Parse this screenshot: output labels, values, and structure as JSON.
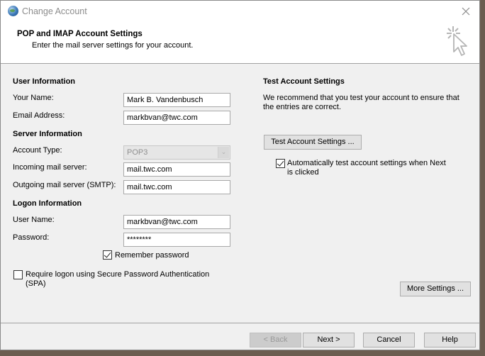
{
  "window": {
    "title": "Change Account",
    "close_icon": "close-icon",
    "app_icon": "outlook-globe-icon"
  },
  "header": {
    "title": "POP and IMAP Account Settings",
    "subtitle": "Enter the mail server settings for your account.",
    "icon": "wizard-cursor-icon"
  },
  "user_information": {
    "heading": "User Information",
    "your_name_label": "Your Name:",
    "your_name_value": "Mark B. Vandenbusch",
    "email_label": "Email Address:",
    "email_value": "markbvan@twc.com"
  },
  "server_information": {
    "heading": "Server Information",
    "account_type_label": "Account Type:",
    "account_type_value": "POP3",
    "incoming_label": "Incoming mail server:",
    "incoming_value": "mail.twc.com",
    "outgoing_label": "Outgoing mail server (SMTP):",
    "outgoing_value": "mail.twc.com"
  },
  "logon_information": {
    "heading": "Logon Information",
    "user_name_label": "User Name:",
    "user_name_value": "markbvan@twc.com",
    "password_label": "Password:",
    "password_value": "********",
    "remember_password_label": "Remember password",
    "remember_password_checked": true,
    "spa_label_line1": "Require logon using Secure Password Authentication",
    "spa_label_line2": "(SPA)",
    "spa_checked": false
  },
  "test_settings": {
    "heading": "Test Account Settings",
    "description_line1": "We recommend that you test your account to ensure that",
    "description_line2": "the entries are correct.",
    "test_button": "Test Account Settings ...",
    "auto_test_label_line1": "Automatically test account settings when Next",
    "auto_test_label_line2": "is clicked",
    "auto_test_checked": true
  },
  "more_settings_button": "More Settings ...",
  "footer": {
    "back": "< Back",
    "next": "Next >",
    "cancel": "Cancel",
    "help": "Help"
  }
}
